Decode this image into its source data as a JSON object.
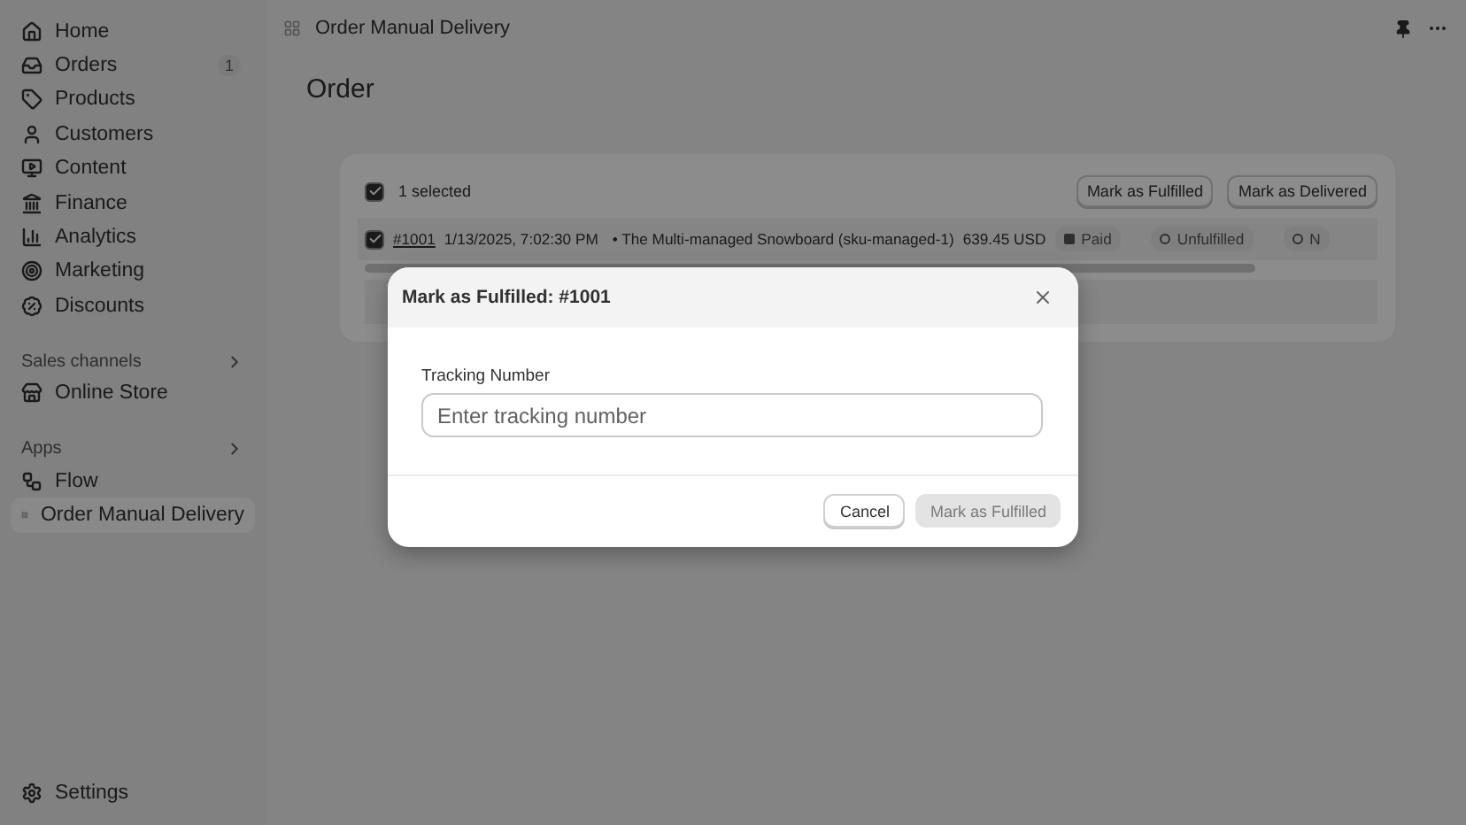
{
  "sidebar": {
    "items": [
      {
        "label": "Home",
        "selected": false
      },
      {
        "label": "Orders",
        "badge": "1",
        "selected": false
      },
      {
        "label": "Products",
        "selected": false
      },
      {
        "label": "Customers",
        "selected": false
      },
      {
        "label": "Content",
        "selected": false
      },
      {
        "label": "Finance",
        "selected": false
      },
      {
        "label": "Analytics",
        "selected": false
      },
      {
        "label": "Marketing",
        "selected": false
      },
      {
        "label": "Discounts",
        "selected": false
      }
    ],
    "sections": [
      {
        "title": "Sales channels",
        "items": [
          {
            "label": "Online Store",
            "selected": false
          }
        ]
      },
      {
        "title": "Apps",
        "items": [
          {
            "label": "Flow",
            "selected": false
          },
          {
            "label": "Order Manual Delivery",
            "selected": true
          }
        ]
      }
    ],
    "footer": {
      "label": "Settings"
    }
  },
  "top_bar": {
    "title": "Order Manual Delivery"
  },
  "page": {
    "title": "Order"
  },
  "table": {
    "selected_count": "1 selected",
    "all_checked": true,
    "actions": [
      "Mark as Fulfilled",
      "Mark as Delivered"
    ],
    "rows": [
      {
        "checked": true,
        "order": "#1001",
        "date": "1/13/2025, 7:02:30 PM",
        "item": "• The Multi-managed Snowboard (sku-managed-1)",
        "total": "639.45 USD",
        "badges": [
          {
            "label": "Paid",
            "kind": "filled"
          },
          {
            "label": "Unfulfilled",
            "kind": "ring"
          },
          {
            "label": "N",
            "kind": "ring"
          }
        ]
      }
    ]
  },
  "modal": {
    "title": "Mark as Fulfilled: #1001",
    "field_label": "Tracking Number",
    "placeholder": "Enter tracking number",
    "buttons": [
      {
        "label": "Cancel",
        "kind": "secondary",
        "disabled": false
      },
      {
        "label": "Mark as Fulfilled",
        "kind": "primary",
        "disabled": true
      }
    ]
  }
}
